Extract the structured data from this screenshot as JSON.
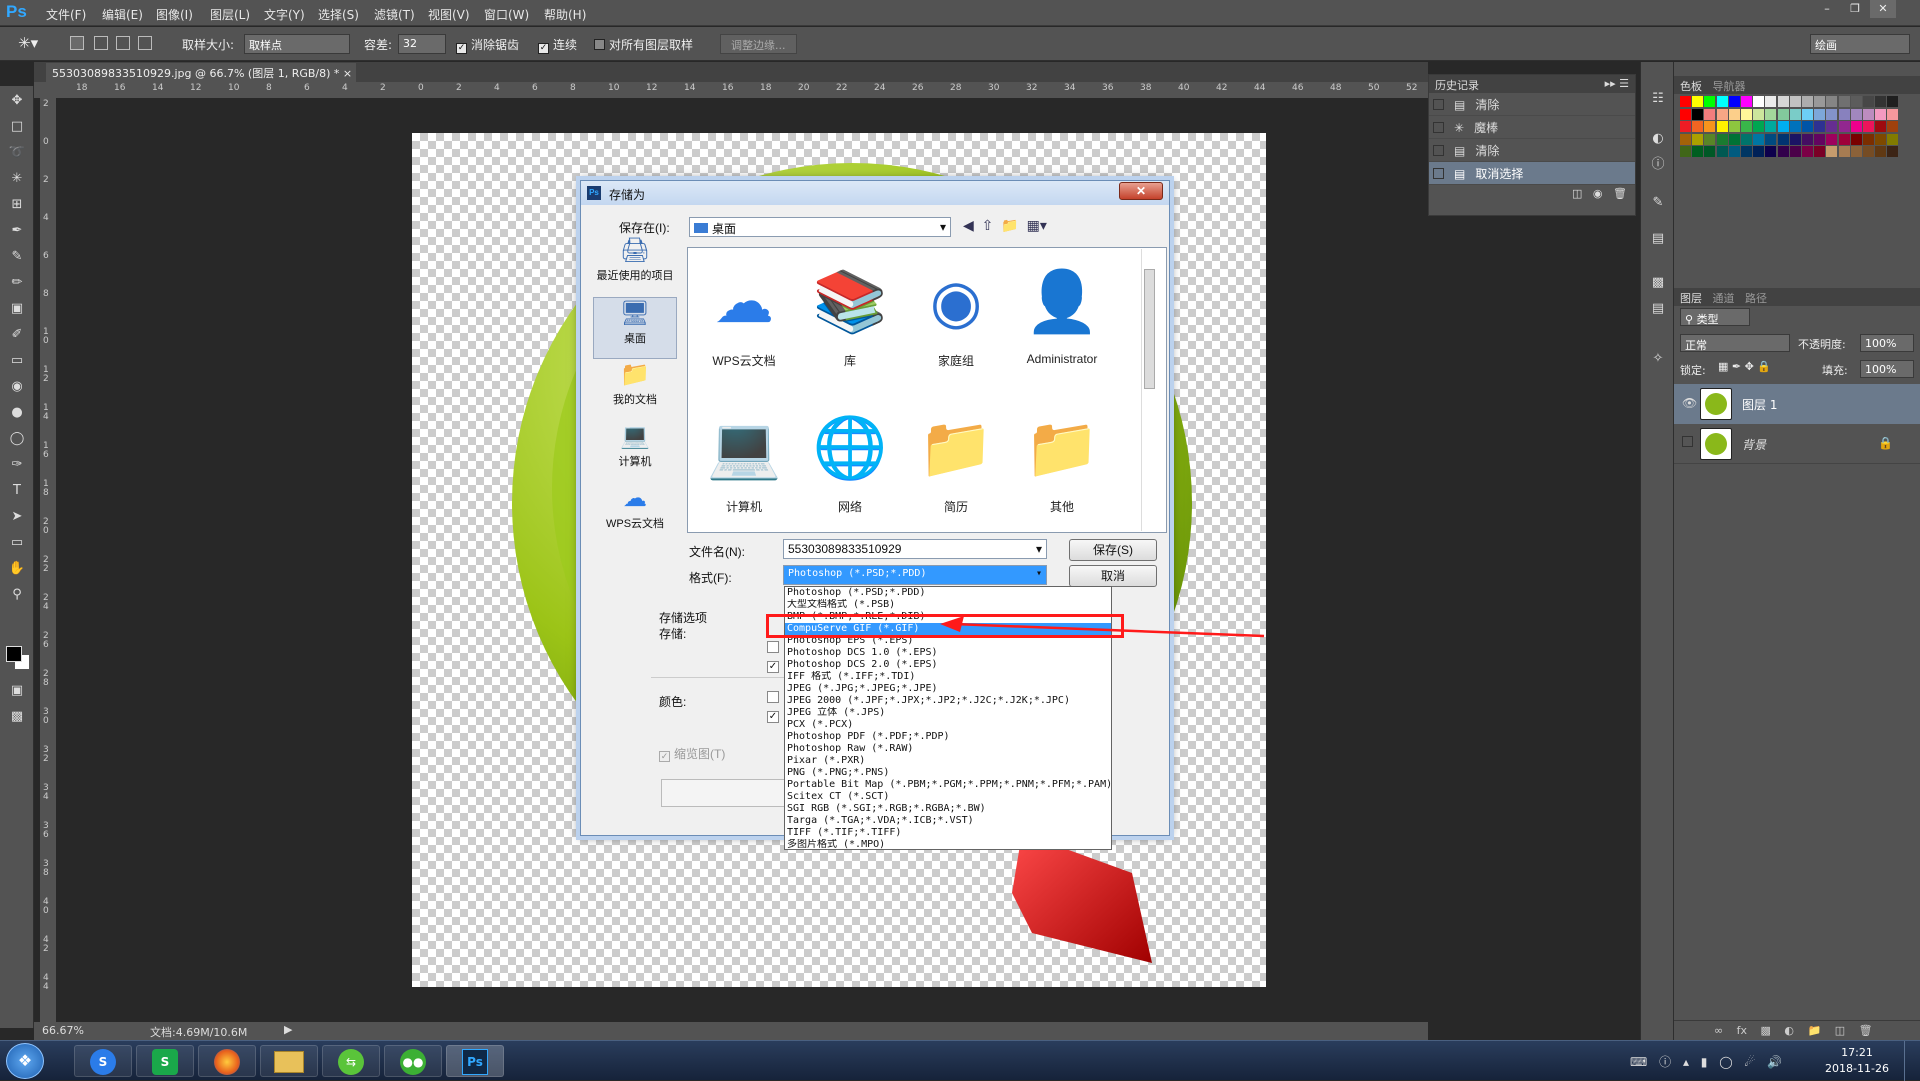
{
  "app": {
    "logo": "Ps"
  },
  "menubar": {
    "items": [
      "文件(F)",
      "编辑(E)",
      "图像(I)",
      "图层(L)",
      "文字(Y)",
      "选择(S)",
      "滤镜(T)",
      "视图(V)",
      "窗口(W)",
      "帮助(H)"
    ]
  },
  "options": {
    "sample_size_label": "取样大小:",
    "sample_size_value": "取样点",
    "tolerance_label": "容差:",
    "tolerance_value": "32",
    "antialias_label": "消除锯齿",
    "contiguous_label": "连续",
    "all_layers_label": "对所有图层取样",
    "refine_edge_label": "调整边缘...",
    "workspace_value": "绘画"
  },
  "document": {
    "tab_title": "55303089833510929.jpg @ 66.7% (图层 1, RGB/8) *"
  },
  "ruler": {
    "h_ticks": [
      "18",
      "16",
      "14",
      "12",
      "10",
      "8",
      "6",
      "4",
      "2",
      "0",
      "2",
      "4",
      "6",
      "8",
      "10",
      "12",
      "14",
      "16",
      "18",
      "20",
      "22",
      "24",
      "26",
      "28",
      "30",
      "32",
      "34",
      "36",
      "38",
      "40",
      "42",
      "44",
      "46",
      "48",
      "50",
      "52"
    ],
    "v_ticks": [
      "2",
      "0",
      "2",
      "4",
      "6",
      "8",
      "1\n0",
      "1\n2",
      "1\n4",
      "1\n6",
      "1\n8",
      "2\n0",
      "2\n2",
      "2\n4",
      "2\n6",
      "2\n8",
      "3\n0",
      "3\n2",
      "3\n4",
      "3\n6",
      "3\n8",
      "4\n0",
      "4\n2",
      "4\n4"
    ]
  },
  "status": {
    "zoom": "66.67%",
    "doc_info": "文档:4.69M/10.6M"
  },
  "history": {
    "tab": "历史记录",
    "items": [
      {
        "label": "清除",
        "icon": "document-icon"
      },
      {
        "label": "魔棒",
        "icon": "magic-wand-icon"
      },
      {
        "label": "清除",
        "icon": "document-icon"
      },
      {
        "label": "取消选择",
        "icon": "document-icon",
        "selected": true
      }
    ]
  },
  "swatches": {
    "tabs": [
      "色板",
      "导航器"
    ],
    "colors": [
      "#ff0000",
      "#ffff00",
      "#00ff00",
      "#00ffff",
      "#0000ff",
      "#ff00ff",
      "#ffffff",
      "#ebebeb",
      "#d6d6d6",
      "#c2c2c2",
      "#adadad",
      "#999999",
      "#858585",
      "#707070",
      "#5c5c5c",
      "#474747",
      "#333333",
      "#1f1f1f",
      "#ff0000",
      "#000000",
      "#f27d7d",
      "#f7a685",
      "#fccf8a",
      "#fff799",
      "#cce69c",
      "#a3d89c",
      "#82ca9c",
      "#7accc8",
      "#6dcff6",
      "#7da7d9",
      "#8393ca",
      "#8881be",
      "#a187be",
      "#bd8cbf",
      "#f49ac1",
      "#f5989d",
      "#ed1c24",
      "#f26522",
      "#f7941d",
      "#fff200",
      "#8dc63f",
      "#39b54a",
      "#00a651",
      "#00a99d",
      "#00aeef",
      "#0072bc",
      "#0054a6",
      "#2e3192",
      "#662d91",
      "#92278f",
      "#ec008c",
      "#ed145b",
      "#9e0b0f",
      "#a0410d",
      "#a36209",
      "#aba000",
      "#598527",
      "#1a7b30",
      "#007236",
      "#00746b",
      "#0076a3",
      "#004a80",
      "#003471",
      "#1b1464",
      "#440e62",
      "#630460",
      "#9e005d",
      "#9e0039",
      "#790000",
      "#7b2e00",
      "#7d4900",
      "#827b00",
      "#406618",
      "#005e20",
      "#005826",
      "#005952",
      "#005b7f",
      "#003663",
      "#002157",
      "#0d004c",
      "#32004b",
      "#4b0049",
      "#7b0046",
      "#7a0026",
      "#c69c6d",
      "#a67c52",
      "#8c6239",
      "#754c24",
      "#603913",
      "#3c2415"
    ]
  },
  "layers": {
    "tabs": [
      "图层",
      "通道",
      "路径"
    ],
    "filter_label": "类型",
    "blend_mode": "正常",
    "opacity_label": "不透明度:",
    "opacity_value": "100%",
    "lock_label": "锁定:",
    "fill_label": "填充:",
    "fill_value": "100%",
    "items": [
      {
        "name": "图层 1",
        "selected": true
      },
      {
        "name": "背景",
        "locked": true
      }
    ]
  },
  "dialog": {
    "title": "存储为",
    "save_in_label": "保存在(I):",
    "save_in_value": "桌面",
    "places": [
      "最近使用的项目",
      "桌面",
      "我的文档",
      "计算机",
      "WPS云文档"
    ],
    "files": [
      "WPS云文档",
      "库",
      "家庭组",
      "Administrator",
      "计算机",
      "网络",
      "简历",
      "其他"
    ],
    "filename_label": "文件名(N):",
    "filename_value": "55303089833510929",
    "format_label": "格式(F):",
    "format_value": "Photoshop (*.PSD;*.PDD)",
    "save_button": "保存(S)",
    "cancel_button": "取消",
    "save_options_label": "存储选项",
    "save_label": "存储:",
    "color_label": "颜色:",
    "thumbnail_label": "缩览图(T)"
  },
  "format_list": [
    "Photoshop (*.PSD;*.PDD)",
    "大型文档格式 (*.PSB)",
    "BMP (*.BMP;*.RLE;*.DIB)",
    "CompuServe GIF (*.GIF)",
    "Photoshop EPS (*.EPS)",
    "Photoshop DCS 1.0 (*.EPS)",
    "Photoshop DCS 2.0 (*.EPS)",
    "IFF 格式 (*.IFF;*.TDI)",
    "JPEG (*.JPG;*.JPEG;*.JPE)",
    "JPEG 2000 (*.JPF;*.JPX;*.JP2;*.J2C;*.J2K;*.JPC)",
    "JPEG 立体 (*.JPS)",
    "PCX (*.PCX)",
    "Photoshop PDF (*.PDF;*.PDP)",
    "Photoshop Raw (*.RAW)",
    "Pixar (*.PXR)",
    "PNG (*.PNG;*.PNS)",
    "Portable Bit Map (*.PBM;*.PGM;*.PPM;*.PNM;*.PFM;*.PAM)",
    "Scitex CT (*.SCT)",
    "SGI RGB (*.SGI;*.RGB;*.RGBA;*.BW)",
    "Targa (*.TGA;*.VDA;*.ICB;*.VST)",
    "TIFF (*.TIF;*.TIFF)",
    "多图片格式 (*.MPO)"
  ],
  "format_highlighted_index": 3,
  "annotation": {
    "color": "#ff0000"
  },
  "taskbar": {
    "time": "17:21",
    "date": "2018-11-26"
  }
}
